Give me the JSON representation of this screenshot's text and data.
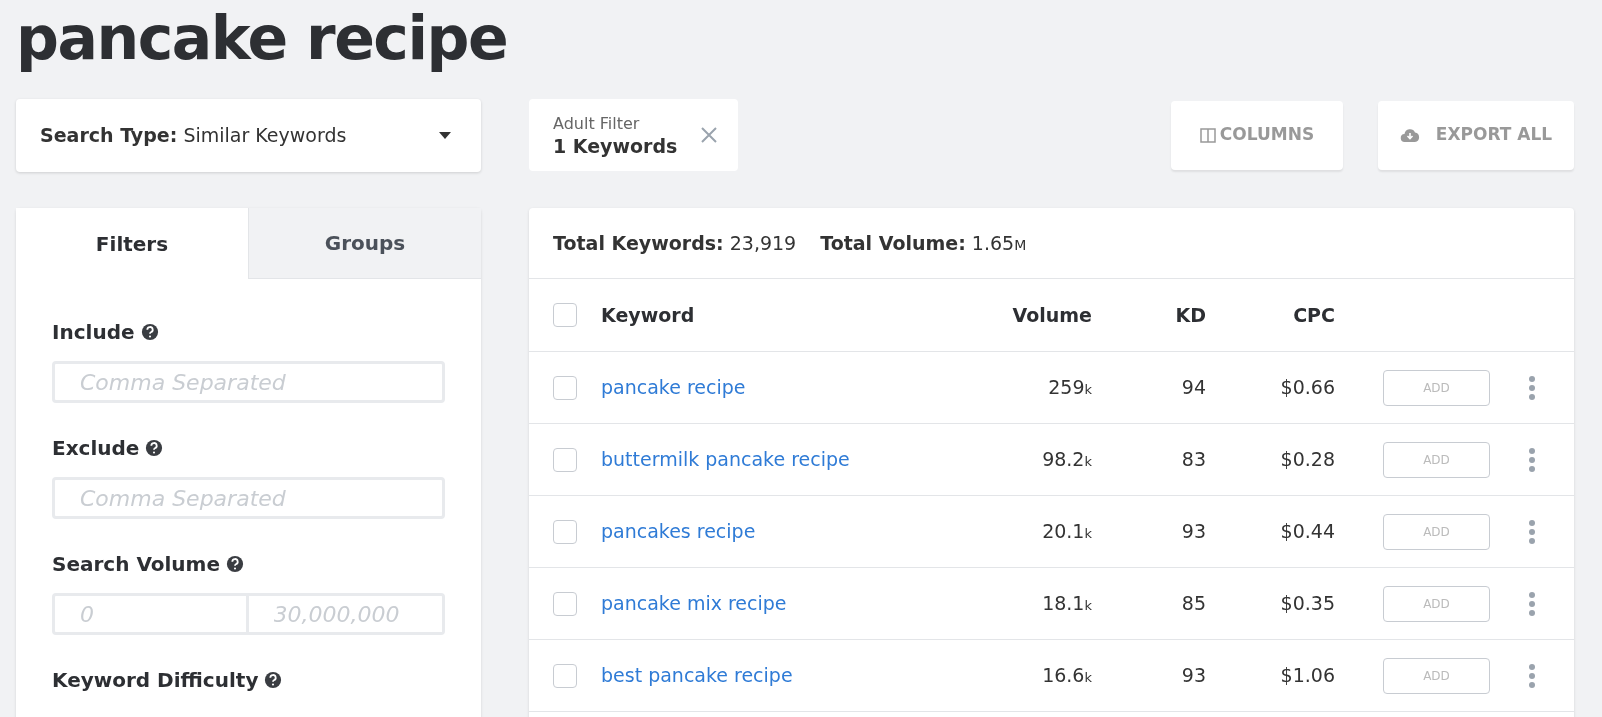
{
  "title": "pancake recipe",
  "search_type": {
    "label": "Search Type:",
    "value": "Similar Keywords"
  },
  "adult_filter": {
    "label": "Adult Filter",
    "value": "1 Keywords"
  },
  "actions": [
    {
      "kind": "columns",
      "label": "COLUMNS"
    },
    {
      "kind": "export",
      "label": "EXPORT ALL"
    }
  ],
  "panel_tabs": [
    {
      "label": "Filters",
      "selected": true
    },
    {
      "label": "Groups",
      "selected": false
    }
  ],
  "filters": [
    {
      "kind": "text",
      "label": "Include",
      "placeholder": "Comma Separated"
    },
    {
      "kind": "text",
      "label": "Exclude",
      "placeholder": "Comma Separated"
    },
    {
      "kind": "range",
      "label": "Search Volume",
      "placeholder_min": "0",
      "placeholder_max": "30,000,000"
    },
    {
      "kind": "range",
      "label": "Keyword Difficulty"
    }
  ],
  "summary": {
    "keywords_label": "Total Keywords:",
    "keywords": "23,919",
    "volume_label": "Total Volume:",
    "volume": "1.65",
    "volume_unit": "M"
  },
  "table": {
    "all_checked": false,
    "columns": [
      "Keyword",
      "Volume",
      "KD",
      "CPC"
    ],
    "rows": [
      {
        "checked": false,
        "keyword": "pancake recipe",
        "volume": "259",
        "unit": "k",
        "kd": "94",
        "cpc": "$0.66",
        "action": "ADD"
      },
      {
        "checked": false,
        "keyword": "buttermilk pancake recipe",
        "volume": "98.2",
        "unit": "k",
        "kd": "83",
        "cpc": "$0.28",
        "action": "ADD"
      },
      {
        "checked": false,
        "keyword": "pancakes recipe",
        "volume": "20.1",
        "unit": "k",
        "kd": "93",
        "cpc": "$0.44",
        "action": "ADD"
      },
      {
        "checked": false,
        "keyword": "pancake mix recipe",
        "volume": "18.1",
        "unit": "k",
        "kd": "85",
        "cpc": "$0.35",
        "action": "ADD"
      },
      {
        "checked": false,
        "keyword": "best pancake recipe",
        "volume": "16.6",
        "unit": "k",
        "kd": "93",
        "cpc": "$1.06",
        "action": "ADD"
      }
    ]
  }
}
